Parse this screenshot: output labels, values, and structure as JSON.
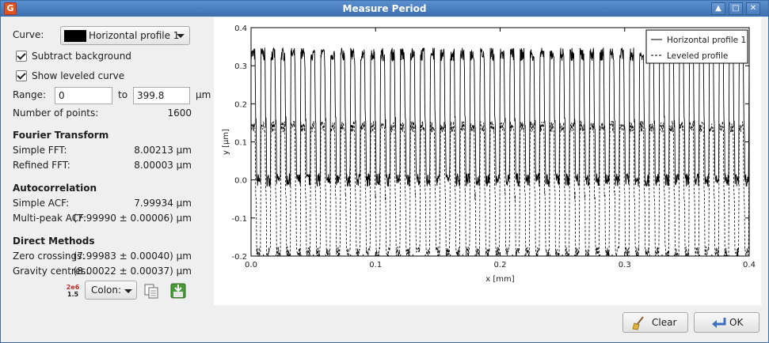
{
  "window": {
    "title": "Measure Period",
    "app_icon_glyph": "G"
  },
  "controls": {
    "curve_label": "Curve:",
    "curve_value": "Horizontal profile 1",
    "subtract_background": "Subtract background",
    "show_leveled": "Show leveled curve",
    "range_label": "Range:",
    "range_from": "0",
    "range_to_label": "to",
    "range_to": "399.8",
    "range_unit": "µm",
    "npoints_label": "Number of points:",
    "npoints_value": "1600"
  },
  "fourier": {
    "heading": "Fourier Transform",
    "simple_label": "Simple FFT:",
    "simple_value": "8.00213 µm",
    "refined_label": "Refined FFT:",
    "refined_value": "8.00003 µm"
  },
  "autocorr": {
    "heading": "Autocorrelation",
    "simple_label": "Simple ACF:",
    "simple_value": "7.99934 µm",
    "multi_label": "Multi-peak ACF:",
    "multi_value": "(7.99990 ± 0.00006) µm"
  },
  "direct": {
    "heading": "Direct Methods",
    "zero_label": "Zero crossings:",
    "zero_value": "(7.99983 ± 0.00040) µm",
    "gravity_label": "Gravity centres:",
    "gravity_value": "(8.00022 ± 0.00037) µm"
  },
  "format": {
    "icon_top": "2e6",
    "icon_bottom": "1.5",
    "separator": "Colon:"
  },
  "buttons": {
    "clear": "Clear",
    "ok": "OK"
  },
  "chart_data": {
    "type": "line",
    "xlabel": "x [mm]",
    "ylabel": "y [µm]",
    "xlim": [
      0.0,
      0.4
    ],
    "ylim": [
      -0.2,
      0.4
    ],
    "xticks": [
      "0.0",
      "0.1",
      "0.2",
      "0.3",
      "0.4"
    ],
    "yticks": [
      "-0.2",
      "-0.1",
      "0.0",
      "0.1",
      "0.2",
      "0.3",
      "0.4"
    ],
    "legend_position": "top-right",
    "period_mm": 0.008,
    "series": [
      {
        "name": "Horizontal profile 1",
        "style": "solid",
        "high": 0.33,
        "low": 0.0,
        "mid_plateau": 0.15
      },
      {
        "name": "Leveled profile",
        "style": "dashed",
        "high": 0.15,
        "low": -0.18
      }
    ]
  }
}
